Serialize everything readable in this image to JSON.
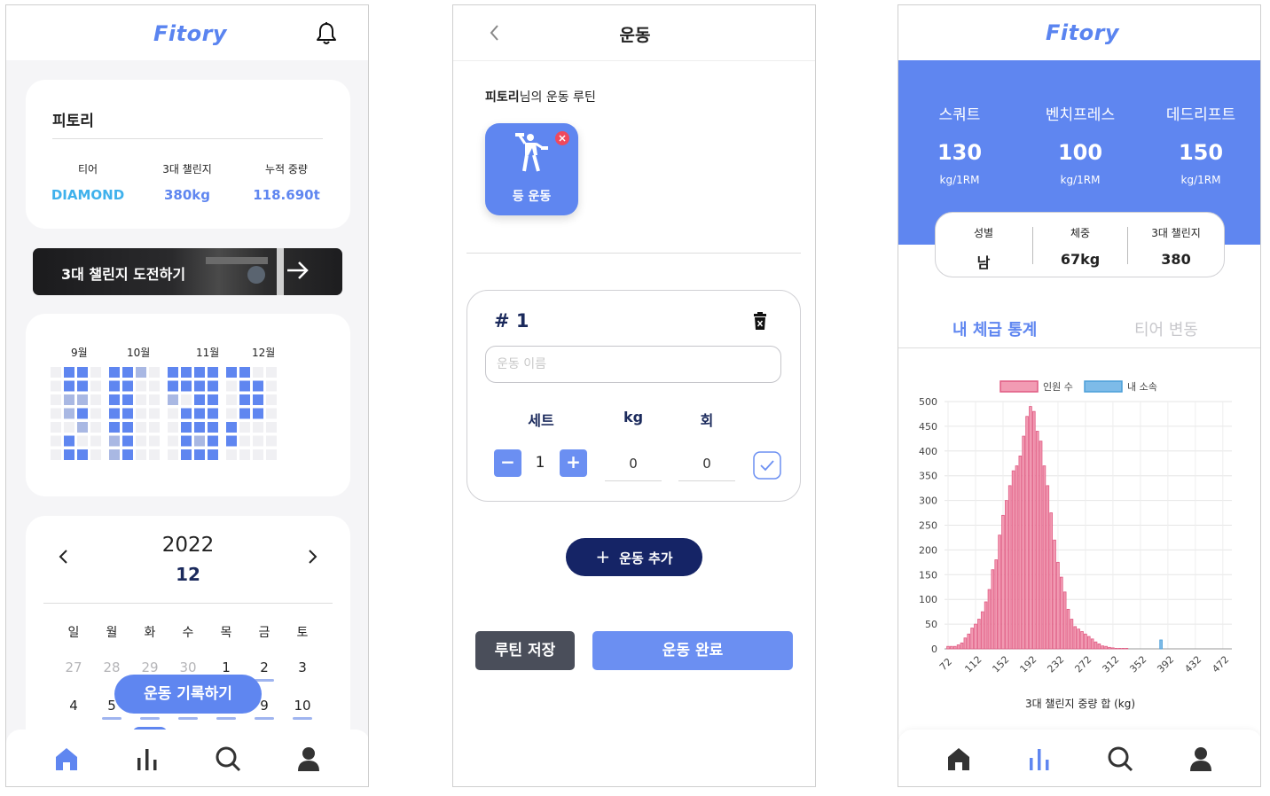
{
  "home": {
    "logo": "Fitory",
    "profile": {
      "name": "피토리",
      "stats": [
        {
          "label": "티어",
          "value": "DIAMOND",
          "color": "#3fb1ec"
        },
        {
          "label": "3대 챌린지",
          "value": "380kg",
          "color": "#5f86f0"
        },
        {
          "label": "누적 중량",
          "value": "118.690t",
          "color": "#5f86f0"
        }
      ]
    },
    "banner": {
      "label": "3대 챌린지 도전하기"
    },
    "heatmap": {
      "months": [
        "9월",
        "10월",
        "11월",
        "12월"
      ],
      "colors": {
        "high": "#5f86f0",
        "mid": "#a9b8e3",
        "low": "#f0f0f3"
      }
    },
    "calendar": {
      "year": "2022",
      "month": "12",
      "weekdays": [
        "일",
        "월",
        "화",
        "수",
        "목",
        "금",
        "토"
      ],
      "row1": [
        "27",
        "28",
        "29",
        "30",
        "1",
        "2",
        "3"
      ],
      "row2": [
        "4",
        "5",
        "",
        "",
        "",
        "9",
        "10"
      ]
    },
    "record_button": "운동 기록하기",
    "tabs": [
      "home-icon",
      "stats-icon",
      "search-icon",
      "profile-icon"
    ]
  },
  "workout": {
    "title": "운동",
    "routine_heading_bold": "피토리",
    "routine_heading_rest": "님의 운동 루틴",
    "routine_tile": "등 운동",
    "set_card": {
      "number": "# 1",
      "name_placeholder": "운동 이름",
      "col_set": "세트",
      "col_kg": "kg",
      "col_reps": "회",
      "set_value": "1",
      "kg_value": "0",
      "reps_value": "0"
    },
    "add_button": "운동 추가",
    "save_button": "루틴 저장",
    "done_button": "운동 완료"
  },
  "stats": {
    "logo": "Fitory",
    "lifts": [
      {
        "name": "스쿼트",
        "value": "130",
        "unit": "kg/1RM"
      },
      {
        "name": "벤치프레스",
        "value": "100",
        "unit": "kg/1RM"
      },
      {
        "name": "데드리프트",
        "value": "150",
        "unit": "kg/1RM"
      }
    ],
    "info": [
      {
        "label": "성별",
        "value": "남"
      },
      {
        "label": "체중",
        "value": "67kg"
      },
      {
        "label": "3대 챌린지",
        "value": "380"
      }
    ],
    "tab_active": "내 체급 통계",
    "tab_inactive": "티어 변동",
    "colors": {
      "primary": "#5f86f0",
      "dark_button": "#152466"
    }
  },
  "chart_data": {
    "type": "bar",
    "xlabel": "3대 챌린지 중량 합 (kg)",
    "ylabel": "",
    "ylim": [
      0,
      500
    ],
    "yticks": [
      0,
      50,
      100,
      150,
      200,
      250,
      300,
      350,
      400,
      450,
      500
    ],
    "xtick_labels": [
      "72",
      "112",
      "152",
      "192",
      "232",
      "272",
      "312",
      "352",
      "392",
      "432",
      "472"
    ],
    "legend": [
      "인원 수",
      "내 소속"
    ],
    "series": [
      {
        "name": "인원 수",
        "color": "#f29bb3",
        "x": [
          72,
          77,
          82,
          87,
          92,
          97,
          102,
          107,
          112,
          117,
          122,
          127,
          132,
          137,
          142,
          147,
          152,
          157,
          162,
          167,
          172,
          177,
          182,
          187,
          192,
          197,
          202,
          207,
          212,
          217,
          222,
          227,
          232,
          237,
          242,
          247,
          252,
          257,
          262,
          267,
          272,
          277,
          282,
          287,
          292,
          297,
          302,
          307,
          312,
          317,
          322,
          327,
          332,
          337,
          342,
          347,
          352,
          357,
          362,
          367,
          372,
          377,
          382,
          387,
          392,
          397,
          402,
          407,
          412,
          417,
          422,
          427,
          432,
          437,
          442,
          447,
          452,
          457,
          462,
          467,
          472,
          477
        ],
        "values": [
          5,
          5,
          5,
          8,
          12,
          22,
          30,
          42,
          50,
          60,
          75,
          95,
          120,
          160,
          180,
          230,
          270,
          300,
          330,
          360,
          370,
          390,
          430,
          470,
          490,
          480,
          440,
          420,
          370,
          330,
          275,
          220,
          175,
          145,
          115,
          80,
          60,
          45,
          40,
          35,
          30,
          25,
          20,
          14,
          10,
          6,
          5,
          3,
          2,
          1,
          1,
          1,
          1,
          0,
          0,
          0,
          0,
          0,
          0,
          0,
          0,
          0,
          0,
          0,
          0,
          0,
          0,
          0,
          0,
          0,
          0,
          0,
          0,
          0,
          0,
          0,
          0,
          0,
          0,
          0,
          0,
          0
        ]
      },
      {
        "name": "내 소속",
        "color": "#7dbbe8",
        "x": [
          382
        ],
        "values": [
          18
        ]
      }
    ]
  }
}
